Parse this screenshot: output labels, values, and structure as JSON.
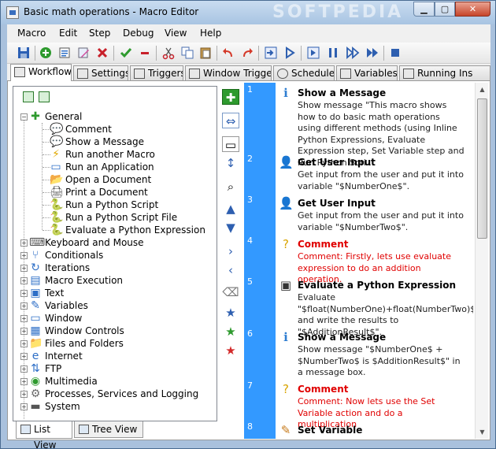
{
  "window": {
    "title": "Basic math operations - Macro Editor",
    "watermark": "SOFTPEDIA"
  },
  "menu": [
    "Macro",
    "Edit",
    "Step",
    "Debug",
    "View",
    "Help"
  ],
  "tabs": [
    "Workflow",
    "Settings",
    "Triggers",
    "Window Triggers",
    "Schedule",
    "Variables",
    "Running Ins"
  ],
  "tree": {
    "group_open": "General",
    "general_items": [
      "Comment",
      "Show a Message",
      "Run another Macro",
      "Run an Application",
      "Open a Document",
      "Print a Document",
      "Run a Python Script",
      "Run a Python Script File",
      "Evaluate a Python Expression"
    ],
    "groups": [
      "Keyboard and Mouse",
      "Conditionals",
      "Iterations",
      "Macro Execution",
      "Text",
      "Variables",
      "Window",
      "Window Controls",
      "Files and Folders",
      "Internet",
      "FTP",
      "Multimedia",
      "Processes, Services and Logging",
      "System"
    ]
  },
  "bottom_tabs": [
    "List View",
    "Tree View"
  ],
  "steps": [
    {
      "num": "1",
      "title": "Show a Message",
      "desc": "Show message \"This macro shows how to do basic math operations using different methods (using Inline Python Expressions, Evaluate Expression step, Set Variable step and Run Python Scri...",
      "type": "normal",
      "icon": "message-icon"
    },
    {
      "num": "2",
      "title": "Get User Input",
      "desc": "Get input from the user and put it into variable \"$NumberOne$\".",
      "type": "normal",
      "icon": "user-input-icon"
    },
    {
      "num": "3",
      "title": "Get User Input",
      "desc": "Get input from the user and put it into variable \"$NumberTwo$\".",
      "type": "normal",
      "icon": "user-input-icon"
    },
    {
      "num": "4",
      "title": "Comment",
      "desc": "Comment: Firstly, lets use evaluate expression to do an addition operation.",
      "type": "comment",
      "icon": "comment-icon"
    },
    {
      "num": "5",
      "title": "Evaluate a Python Expression",
      "desc": "Evaluate \"$float(NumberOne)+float(NumberTwo)$\" and write the results to \"$AdditionResult$\".",
      "type": "normal",
      "icon": "python-icon"
    },
    {
      "num": "6",
      "title": "Show a Message",
      "desc": "Show message \"$NumberOne$ + $NumberTwo$ is $AdditionResult$\" in a message box.",
      "type": "normal",
      "icon": "message-icon"
    },
    {
      "num": "7",
      "title": "Comment",
      "desc": "Comment: Now lets use the Set Variable action and do a multiplication",
      "type": "comment",
      "icon": "comment-icon"
    },
    {
      "num": "8",
      "title": "Set Variable",
      "desc": "",
      "type": "normal",
      "icon": "set-variable-icon"
    }
  ],
  "colors": {
    "step_number_column": "#3399ff",
    "comment_text": "#e00000",
    "titlebar": "#b8cfe8"
  }
}
